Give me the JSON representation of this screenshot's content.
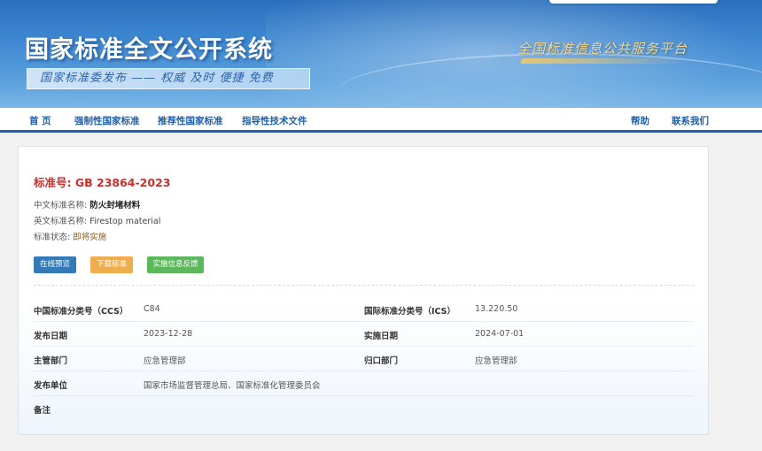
{
  "site": {
    "title": "国家标准全文公开系统",
    "subtitle": "国家标准委发布 —— 权威  及时  便捷  免费",
    "slogan": "全国标准信息公共服务平台"
  },
  "nav": {
    "items": [
      "首 页",
      "强制性国家标准",
      "推荐性国家标准",
      "指导性技术文件"
    ],
    "right_items": [
      "帮助",
      "联系我们"
    ]
  },
  "standard": {
    "number_label": "标准号:",
    "number": "GB 23864-2023",
    "cn_name_label": "中文标准名称:",
    "cn_name": "防火封堵材料",
    "en_name_label": "英文标准名称:",
    "en_name": "Firestop material",
    "status_label": "标准状态:",
    "status": "即将实施"
  },
  "buttons": {
    "preview": "在线预览",
    "download": "下载标准",
    "feedback": "实施信息反馈"
  },
  "details": {
    "ccs_label": "中国标准分类号（CCS）",
    "ccs": "C84",
    "ics_label": "国际标准分类号（ICS）",
    "ics": "13.220.50",
    "publish_date_label": "发布日期",
    "publish_date": "2023-12-28",
    "implement_date_label": "实施日期",
    "implement_date": "2024-07-01",
    "dept_label": "主管部门",
    "dept": "应急管理部",
    "owner_label": "归口部门",
    "owner": "应急管理部",
    "publisher_label": "发布单位",
    "publisher": "国家市场监督管理总局、国家标准化管理委员会",
    "remark_label": "备注"
  },
  "colors": {
    "brand": "#1f5ea8",
    "std_number": "#c9302c",
    "btn_preview": "#337ab7",
    "btn_download": "#f0ad4e",
    "btn_feedback": "#5cb85c"
  }
}
